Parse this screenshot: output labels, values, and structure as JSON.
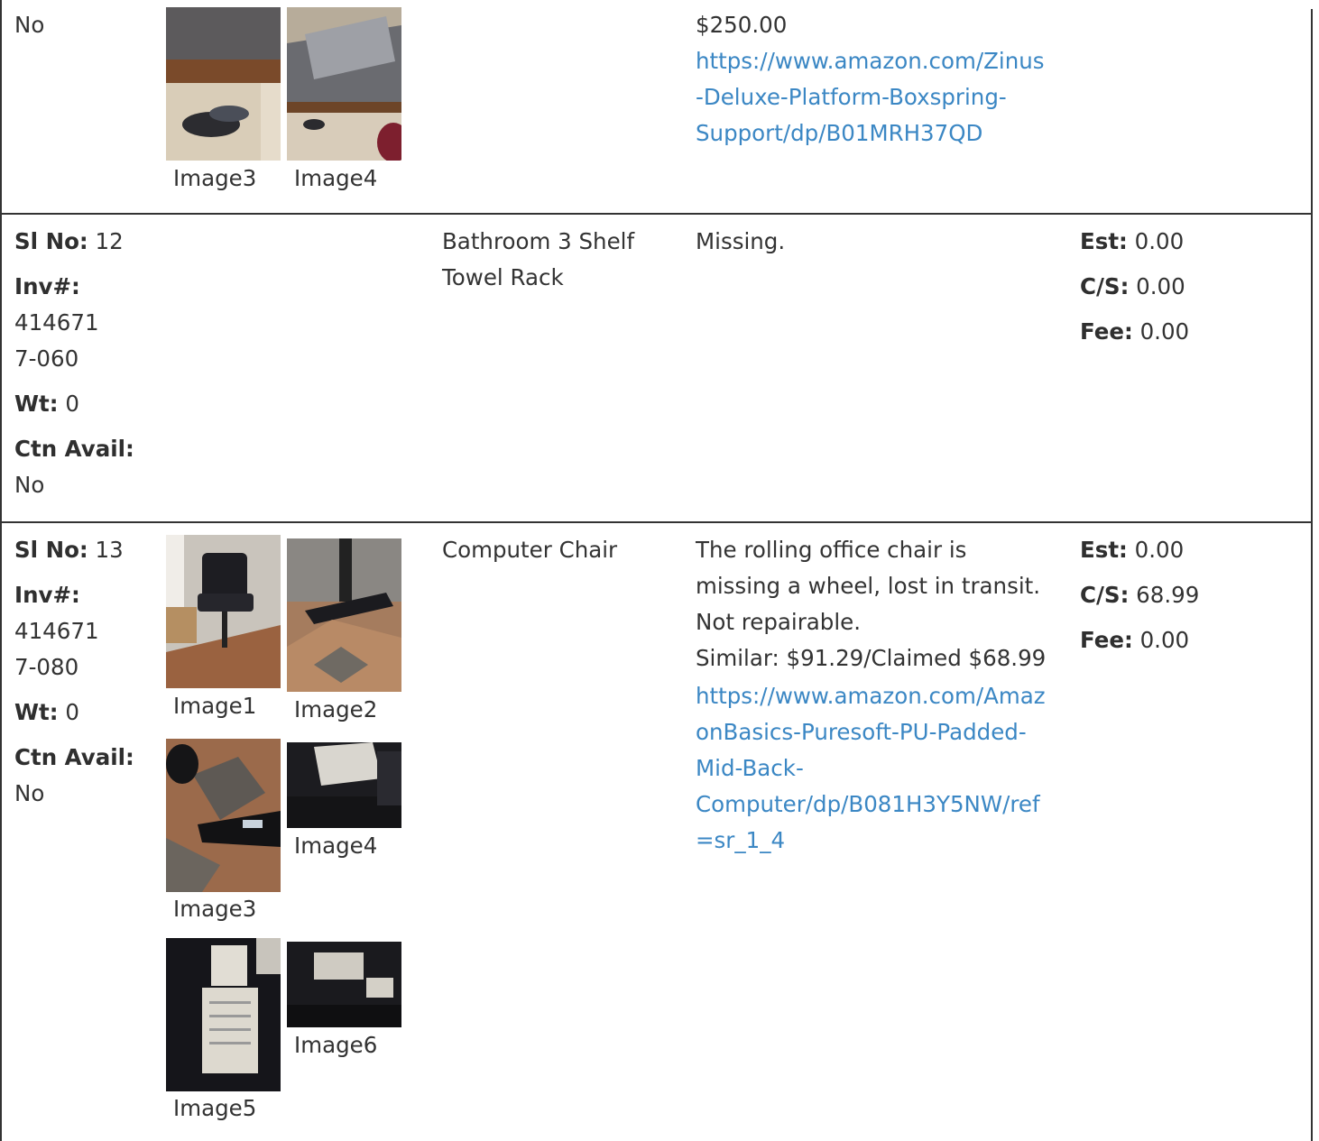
{
  "row11": {
    "ctn_value": "No",
    "images": [
      "Image3",
      "Image4"
    ],
    "price": "$250.00",
    "link_lines": [
      "https://www.amazon.com/Zinus",
      "-Deluxe-Platform-Boxspring-",
      "Support/dp/B01MRH37QD"
    ]
  },
  "row12": {
    "sl_label": "Sl No:",
    "sl_value": "12",
    "inv_label": "Inv#:",
    "inv_lines": [
      "414671",
      "7-060"
    ],
    "wt_label": "Wt:",
    "wt_value": "0",
    "ctn_label": "Ctn Avail:",
    "ctn_value": "No",
    "item_lines": [
      "Bathroom 3 Shelf",
      "Towel Rack"
    ],
    "description": "Missing.",
    "est_label": "Est:",
    "est_value": "0.00",
    "cs_label": "C/S:",
    "cs_value": "0.00",
    "fee_label": "Fee:",
    "fee_value": "0.00"
  },
  "row13": {
    "sl_label": "Sl No:",
    "sl_value": "13",
    "inv_label": "Inv#:",
    "inv_lines": [
      "414671",
      "7-080"
    ],
    "wt_label": "Wt:",
    "wt_value": "0",
    "ctn_label": "Ctn Avail:",
    "ctn_value": "No",
    "images": [
      "Image1",
      "Image2",
      "Image3",
      "Image4",
      "Image5",
      "Image6"
    ],
    "item": "Computer Chair",
    "desc_lines": [
      "The rolling office chair is",
      "missing a wheel, lost in transit.",
      "Not repairable.",
      "Similar: $91.29/Claimed $68.99"
    ],
    "link_lines": [
      "https://www.amazon.com/Amaz",
      "onBasics-Puresoft-PU-Padded-",
      "Mid-Back-",
      "Computer/dp/B081H3Y5NW/ref",
      "=sr_1_4"
    ],
    "est_label": "Est:",
    "est_value": "0.00",
    "cs_label": "C/S:",
    "cs_value": "68.99",
    "fee_label": "Fee:",
    "fee_value": "0.00"
  },
  "colors": {
    "text": "#333333",
    "link": "#3b87c4",
    "border": "#333333"
  }
}
